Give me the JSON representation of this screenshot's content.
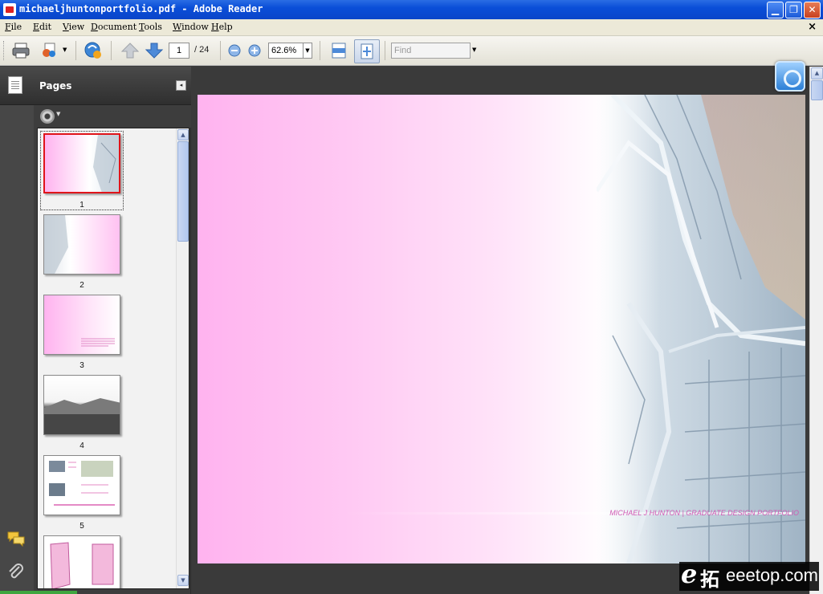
{
  "window": {
    "title": "michaeljhuntonportfolio.pdf - Adobe Reader"
  },
  "menu": {
    "items": [
      {
        "first": "F",
        "rest": "ile"
      },
      {
        "first": "E",
        "rest": "dit"
      },
      {
        "first": "V",
        "rest": "iew"
      },
      {
        "first": "D",
        "rest": "ocument"
      },
      {
        "first": "T",
        "rest": "ools"
      },
      {
        "first": "W",
        "rest": "indow"
      },
      {
        "first": "H",
        "rest": "elp"
      }
    ],
    "close_glyph": "×"
  },
  "toolbar": {
    "page_current": "1",
    "page_total": "/ 24",
    "zoom": "62.6%",
    "find_placeholder": "Find"
  },
  "panel": {
    "title": "Pages",
    "collapse_glyph": "◂",
    "thumbnails": [
      {
        "num": "1",
        "selected": true
      },
      {
        "num": "2",
        "selected": false
      },
      {
        "num": "3",
        "selected": false
      },
      {
        "num": "4",
        "selected": false
      },
      {
        "num": "5",
        "selected": false
      }
    ]
  },
  "document": {
    "footer_text": "MICHAEL J HUNTON  |  GRADUATE DESIGN PORTFOLIO"
  },
  "watermark": {
    "letter": "e",
    "cn": "拓",
    "brand": "eeetop.com"
  },
  "colors": {
    "titlebar": "#0a4ed8",
    "page_pink": "#ffb3ef",
    "footer_pink": "#d05ab4",
    "selection_red": "#e0141a"
  }
}
